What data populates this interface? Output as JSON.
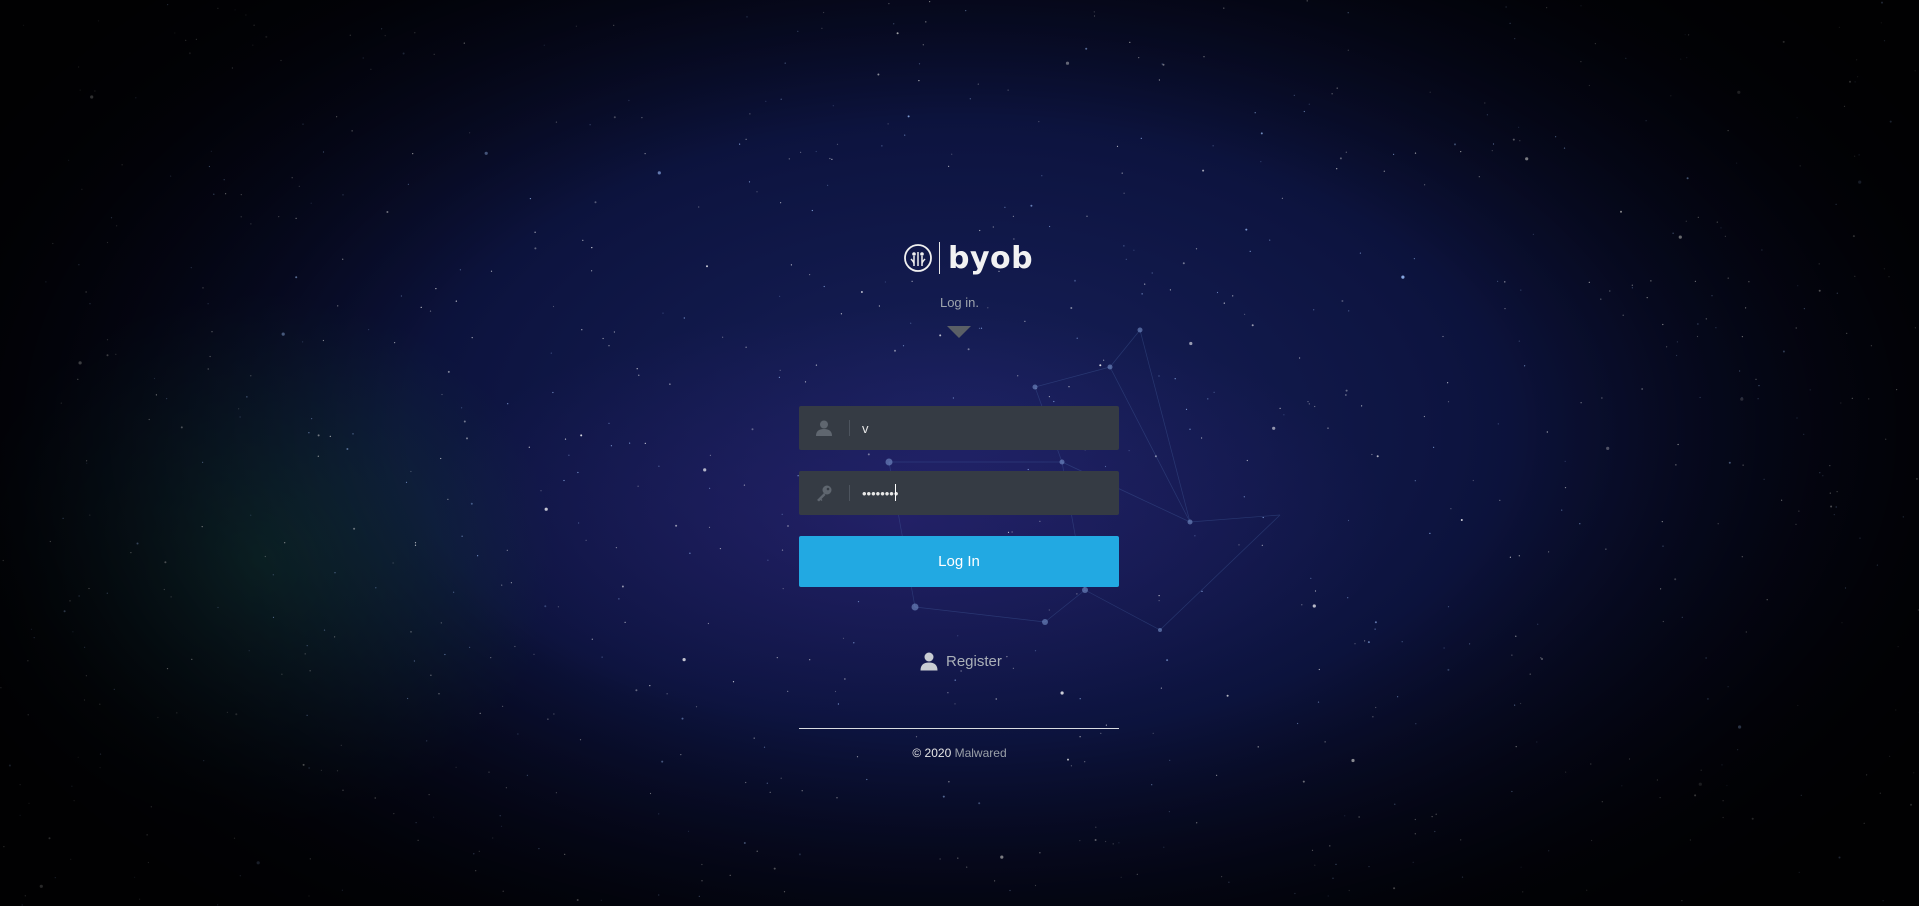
{
  "brand": {
    "name": "byob",
    "logo_icon": "byob-logo-icon"
  },
  "login": {
    "subtitle": "Log in.",
    "username": {
      "value": "v",
      "icon": "user-icon"
    },
    "password": {
      "value": "••••••••",
      "icon": "key-icon"
    },
    "submit_label": "Log In"
  },
  "register": {
    "label": "Register",
    "icon": "user-icon"
  },
  "footer": {
    "copyright": "© 2020",
    "org": "Malwared"
  },
  "colors": {
    "accent": "#22a9e2",
    "field_bg": "#353b44",
    "background": "#0d1440"
  }
}
